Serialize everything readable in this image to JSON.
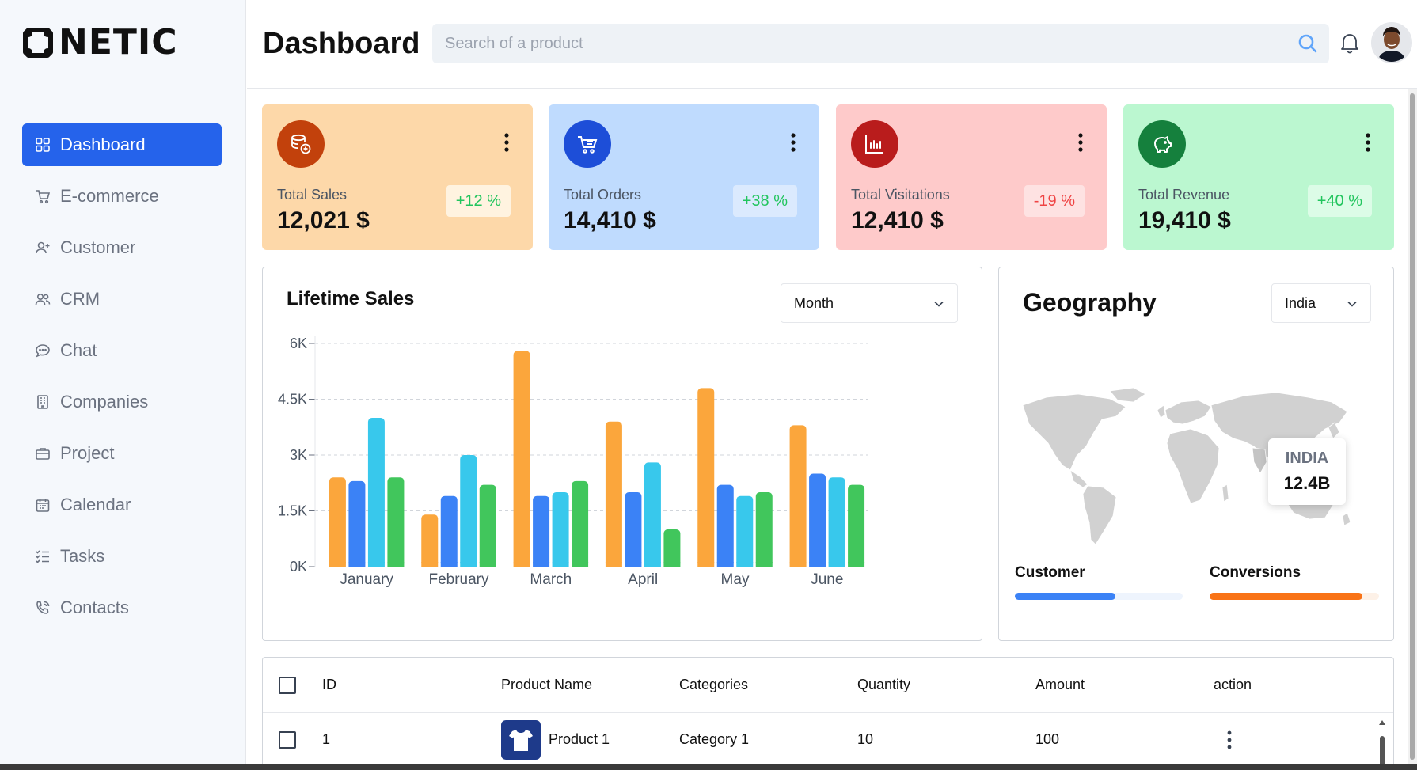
{
  "brand": {
    "name": "NETIC"
  },
  "sidebar": {
    "items": [
      {
        "label": "Dashboard",
        "icon": "grid-icon",
        "active": true
      },
      {
        "label": "E-commerce",
        "icon": "cart-icon"
      },
      {
        "label": "Customer",
        "icon": "user-add-icon"
      },
      {
        "label": "CRM",
        "icon": "users-icon"
      },
      {
        "label": "Chat",
        "icon": "chat-icon"
      },
      {
        "label": "Companies",
        "icon": "building-icon"
      },
      {
        "label": "Project",
        "icon": "briefcase-icon"
      },
      {
        "label": "Calendar",
        "icon": "calendar-icon"
      },
      {
        "label": "Tasks",
        "icon": "list-icon"
      },
      {
        "label": "Contacts",
        "icon": "phone-icon"
      }
    ]
  },
  "header": {
    "title": "Dashboard",
    "search_placeholder": "Search of a product"
  },
  "cards": [
    {
      "label": "Total Sales",
      "value": "12,021 $",
      "delta": "+12 %",
      "bg": "#fdd8a9",
      "icon_bg": "#c2410c",
      "delta_bg": "#fff3e0",
      "delta_color": "#22c55e",
      "icon": "database-add-icon"
    },
    {
      "label": "Total Orders",
      "value": "14,410 $",
      "delta": "+38 %",
      "bg": "#bfdbfe",
      "icon_bg": "#1d4ed8",
      "delta_bg": "#dbeafe",
      "delta_color": "#22c55e",
      "icon": "cart-icon"
    },
    {
      "label": "Total Visitations",
      "value": "12,410 $",
      "delta": "-19 %",
      "bg": "#fecaca",
      "icon_bg": "#b91c1c",
      "delta_bg": "#fee2e2",
      "delta_color": "#ef4444",
      "icon": "bar-chart-icon"
    },
    {
      "label": "Total Revenue",
      "value": "19,410 $",
      "delta": "+40 %",
      "bg": "#bbf7d0",
      "icon_bg": "#15803d",
      "delta_bg": "#dcfce7",
      "delta_color": "#22c55e",
      "icon": "piggy-bank-icon"
    }
  ],
  "lifetime_sales": {
    "title": "Lifetime Sales",
    "period_select": "Month"
  },
  "chart_data": {
    "type": "bar",
    "title": "Lifetime Sales",
    "categories": [
      "January",
      "February",
      "March",
      "April",
      "May",
      "June"
    ],
    "ytick_labels": [
      "0K",
      "1.5K",
      "3K",
      "4.5K",
      "6K"
    ],
    "ylim": [
      0,
      6000
    ],
    "grid": true,
    "series": [
      {
        "color": "#fba63c",
        "values": [
          2400,
          1400,
          5800,
          3900,
          4800,
          3800
        ]
      },
      {
        "color": "#3b82f6",
        "values": [
          2300,
          1900,
          1900,
          2000,
          2200,
          2500
        ]
      },
      {
        "color": "#38c8ec",
        "values": [
          4000,
          3000,
          2000,
          2800,
          1900,
          2400
        ]
      },
      {
        "color": "#41c65c",
        "values": [
          2400,
          2200,
          2300,
          1000,
          2000,
          2200
        ]
      }
    ]
  },
  "geography": {
    "title": "Geography",
    "country_select": "India",
    "tooltip_country": "INDIA",
    "tooltip_value": "12.4B",
    "customer_label": "Customer",
    "conversions_label": "Conversions",
    "customer_progress": 0.6,
    "conversions_progress": 0.9,
    "customer_color": "#3b82f6",
    "conversions_color": "#f97316"
  },
  "table": {
    "headers": {
      "id": "ID",
      "product": "Product Name",
      "category": "Categories",
      "quantity": "Quantity",
      "amount": "Amount",
      "action": "action"
    },
    "rows": [
      {
        "id": "1",
        "product": "Product 1",
        "category": "Category 1",
        "quantity": "10",
        "amount": "100"
      }
    ]
  }
}
